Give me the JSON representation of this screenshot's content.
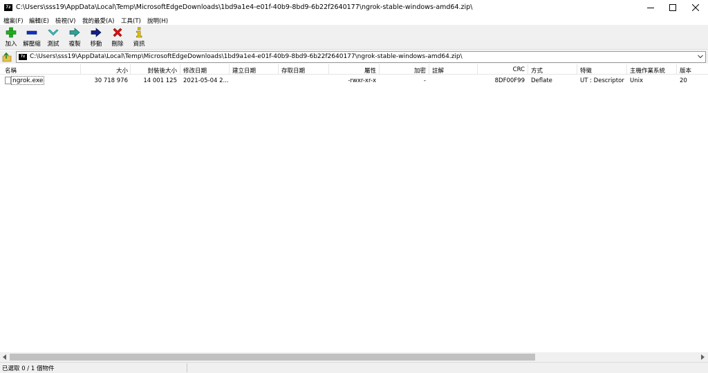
{
  "window": {
    "title": "C:\\Users\\sss19\\AppData\\Local\\Temp\\MicrosoftEdgeDownloads\\1bd9a1e4-e01f-40b9-8bd9-6b22f2640177\\ngrok-stable-windows-amd64.zip\\",
    "app_icon_text": "7z"
  },
  "menu": [
    "檔案(F)",
    "編輯(E)",
    "檢視(V)",
    "我的最愛(A)",
    "工具(T)",
    "說明(H)"
  ],
  "toolbar": {
    "add": "加入",
    "extract": "解壓縮",
    "test": "測試",
    "copy": "複製",
    "move": "移動",
    "delete": "刪除",
    "info": "資訊"
  },
  "address": {
    "path": "C:\\Users\\sss19\\AppData\\Local\\Temp\\MicrosoftEdgeDownloads\\1bd9a1e4-e01f-40b9-8bd9-6b22f2640177\\ngrok-stable-windows-amd64.zip\\"
  },
  "columns": {
    "name": "名稱",
    "size": "大小",
    "packed": "封裝後大小",
    "modified": "修改日期",
    "created": "建立日期",
    "accessed": "存取日期",
    "attributes": "屬性",
    "encrypted": "加密",
    "comment": "註解",
    "crc": "CRC",
    "method": "方式",
    "characteristics": "特徵",
    "host_os": "主機作業系統",
    "version": "版本"
  },
  "files": [
    {
      "name": "ngrok.exe",
      "size": "30 718 976",
      "packed": "14 001 125",
      "modified": "2021-05-04 2...",
      "created": "",
      "accessed": "",
      "attributes": "-rwxr-xr-x",
      "encrypted": "-",
      "comment": "",
      "crc": "8DF00F99",
      "method": "Deflate",
      "characteristics": "UT : Descriptor",
      "host_os": "Unix",
      "version": "20"
    }
  ],
  "status": {
    "selection": "已選取 0 / 1 個物件"
  }
}
